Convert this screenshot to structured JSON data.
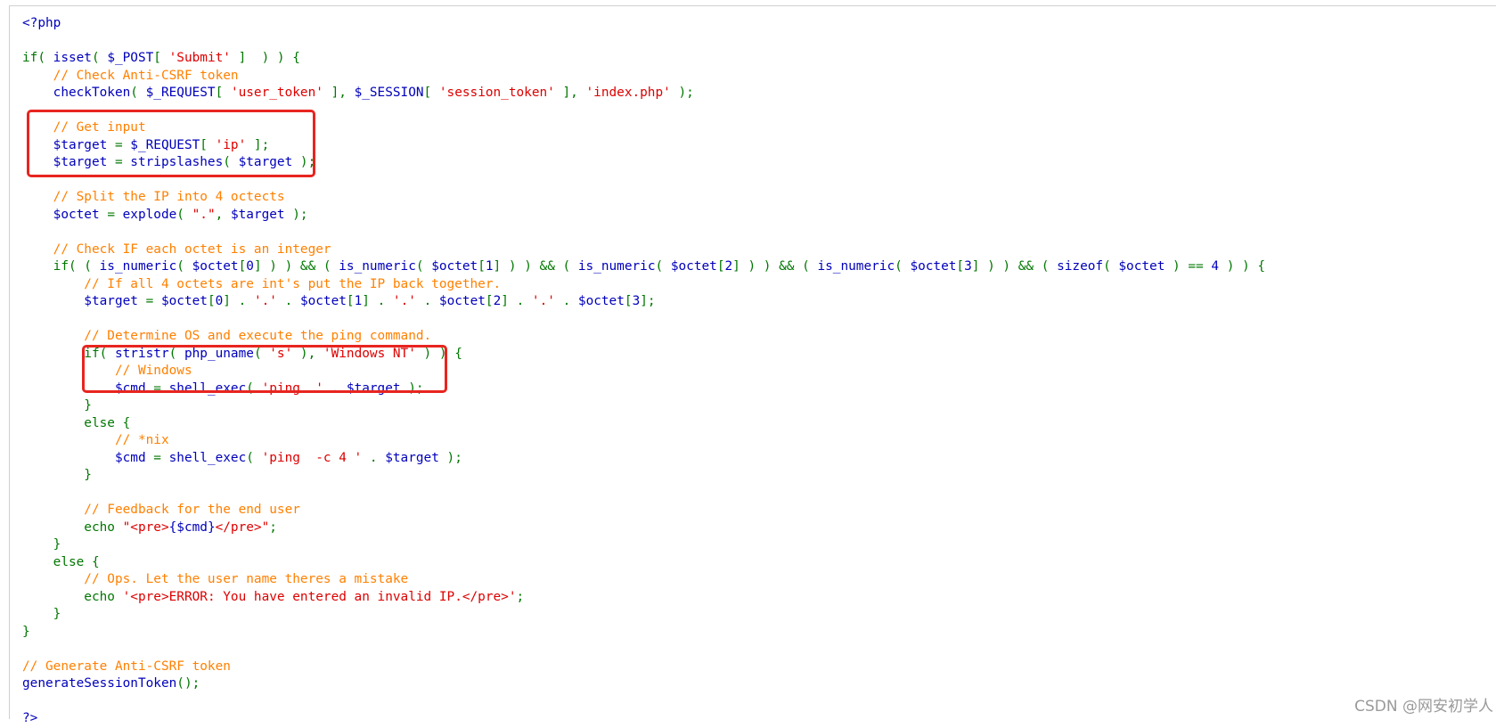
{
  "code_lines": [
    [
      {
        "t": "php",
        "v": "<?php"
      }
    ],
    [],
    [
      {
        "t": "kw",
        "v": "if( "
      },
      {
        "t": "fn",
        "v": "isset"
      },
      {
        "t": "kw",
        "v": "( "
      },
      {
        "t": "fn",
        "v": "$_POST"
      },
      {
        "t": "kw",
        "v": "[ "
      },
      {
        "t": "str",
        "v": "'Submit'"
      },
      {
        "t": "kw",
        "v": " ]  ) ) {"
      }
    ],
    [
      {
        "t": "com",
        "v": "    // Check Anti-CSRF token"
      }
    ],
    [
      {
        "t": "fn",
        "v": "    checkToken"
      },
      {
        "t": "kw",
        "v": "( "
      },
      {
        "t": "fn",
        "v": "$_REQUEST"
      },
      {
        "t": "kw",
        "v": "[ "
      },
      {
        "t": "str",
        "v": "'user_token'"
      },
      {
        "t": "kw",
        "v": " ], "
      },
      {
        "t": "fn",
        "v": "$_SESSION"
      },
      {
        "t": "kw",
        "v": "[ "
      },
      {
        "t": "str",
        "v": "'session_token'"
      },
      {
        "t": "kw",
        "v": " ], "
      },
      {
        "t": "str",
        "v": "'index.php'"
      },
      {
        "t": "kw",
        "v": " );"
      }
    ],
    [],
    [
      {
        "t": "com",
        "v": "    // Get input"
      }
    ],
    [
      {
        "t": "fn",
        "v": "    $target "
      },
      {
        "t": "kw",
        "v": "= "
      },
      {
        "t": "fn",
        "v": "$_REQUEST"
      },
      {
        "t": "kw",
        "v": "[ "
      },
      {
        "t": "str",
        "v": "'ip'"
      },
      {
        "t": "kw",
        "v": " ];"
      }
    ],
    [
      {
        "t": "fn",
        "v": "    $target "
      },
      {
        "t": "kw",
        "v": "= "
      },
      {
        "t": "fn",
        "v": "stripslashes"
      },
      {
        "t": "kw",
        "v": "( "
      },
      {
        "t": "fn",
        "v": "$target "
      },
      {
        "t": "kw",
        "v": ");"
      }
    ],
    [],
    [
      {
        "t": "com",
        "v": "    // Split the IP into 4 octects"
      }
    ],
    [
      {
        "t": "fn",
        "v": "    $octet "
      },
      {
        "t": "kw",
        "v": "= "
      },
      {
        "t": "fn",
        "v": "explode"
      },
      {
        "t": "kw",
        "v": "( "
      },
      {
        "t": "str",
        "v": "\".\""
      },
      {
        "t": "kw",
        "v": ", "
      },
      {
        "t": "fn",
        "v": "$target "
      },
      {
        "t": "kw",
        "v": ");"
      }
    ],
    [],
    [
      {
        "t": "com",
        "v": "    // Check IF each octet is an integer"
      }
    ],
    [
      {
        "t": "kw",
        "v": "    if( ( "
      },
      {
        "t": "fn",
        "v": "is_numeric"
      },
      {
        "t": "kw",
        "v": "( "
      },
      {
        "t": "fn",
        "v": "$octet"
      },
      {
        "t": "kw",
        "v": "["
      },
      {
        "t": "fn",
        "v": "0"
      },
      {
        "t": "kw",
        "v": "] ) ) && ( "
      },
      {
        "t": "fn",
        "v": "is_numeric"
      },
      {
        "t": "kw",
        "v": "( "
      },
      {
        "t": "fn",
        "v": "$octet"
      },
      {
        "t": "kw",
        "v": "["
      },
      {
        "t": "fn",
        "v": "1"
      },
      {
        "t": "kw",
        "v": "] ) ) && ( "
      },
      {
        "t": "fn",
        "v": "is_numeric"
      },
      {
        "t": "kw",
        "v": "( "
      },
      {
        "t": "fn",
        "v": "$octet"
      },
      {
        "t": "kw",
        "v": "["
      },
      {
        "t": "fn",
        "v": "2"
      },
      {
        "t": "kw",
        "v": "] ) ) && ( "
      },
      {
        "t": "fn",
        "v": "is_numeric"
      },
      {
        "t": "kw",
        "v": "( "
      },
      {
        "t": "fn",
        "v": "$octet"
      },
      {
        "t": "kw",
        "v": "["
      },
      {
        "t": "fn",
        "v": "3"
      },
      {
        "t": "kw",
        "v": "] ) ) && ( "
      },
      {
        "t": "fn",
        "v": "sizeof"
      },
      {
        "t": "kw",
        "v": "( "
      },
      {
        "t": "fn",
        "v": "$octet "
      },
      {
        "t": "kw",
        "v": ") == "
      },
      {
        "t": "fn",
        "v": "4 "
      },
      {
        "t": "kw",
        "v": ") ) {"
      }
    ],
    [
      {
        "t": "com",
        "v": "        // If all 4 octets are int's put the IP back together."
      }
    ],
    [
      {
        "t": "fn",
        "v": "        $target "
      },
      {
        "t": "kw",
        "v": "= "
      },
      {
        "t": "fn",
        "v": "$octet"
      },
      {
        "t": "kw",
        "v": "["
      },
      {
        "t": "fn",
        "v": "0"
      },
      {
        "t": "kw",
        "v": "] . "
      },
      {
        "t": "str",
        "v": "'.'"
      },
      {
        "t": "kw",
        "v": " . "
      },
      {
        "t": "fn",
        "v": "$octet"
      },
      {
        "t": "kw",
        "v": "["
      },
      {
        "t": "fn",
        "v": "1"
      },
      {
        "t": "kw",
        "v": "] . "
      },
      {
        "t": "str",
        "v": "'.'"
      },
      {
        "t": "kw",
        "v": " . "
      },
      {
        "t": "fn",
        "v": "$octet"
      },
      {
        "t": "kw",
        "v": "["
      },
      {
        "t": "fn",
        "v": "2"
      },
      {
        "t": "kw",
        "v": "] . "
      },
      {
        "t": "str",
        "v": "'.'"
      },
      {
        "t": "kw",
        "v": " . "
      },
      {
        "t": "fn",
        "v": "$octet"
      },
      {
        "t": "kw",
        "v": "["
      },
      {
        "t": "fn",
        "v": "3"
      },
      {
        "t": "kw",
        "v": "];"
      }
    ],
    [],
    [
      {
        "t": "com",
        "v": "        // Determine OS and execute the ping command."
      }
    ],
    [
      {
        "t": "kw",
        "v": "        if( "
      },
      {
        "t": "fn",
        "v": "stristr"
      },
      {
        "t": "kw",
        "v": "( "
      },
      {
        "t": "fn",
        "v": "php_uname"
      },
      {
        "t": "kw",
        "v": "( "
      },
      {
        "t": "str",
        "v": "'s'"
      },
      {
        "t": "kw",
        "v": " ), "
      },
      {
        "t": "str",
        "v": "'Windows NT'"
      },
      {
        "t": "kw",
        "v": " ) ) {"
      }
    ],
    [
      {
        "t": "com",
        "v": "            // Windows"
      }
    ],
    [
      {
        "t": "fn",
        "v": "            $cmd "
      },
      {
        "t": "kw",
        "v": "= "
      },
      {
        "t": "fn",
        "v": "shell_exec"
      },
      {
        "t": "kw",
        "v": "( "
      },
      {
        "t": "str",
        "v": "'ping  '"
      },
      {
        "t": "kw",
        "v": " . "
      },
      {
        "t": "fn",
        "v": "$target "
      },
      {
        "t": "kw",
        "v": ");"
      }
    ],
    [
      {
        "t": "kw",
        "v": "        }"
      }
    ],
    [
      {
        "t": "kw",
        "v": "        else {"
      }
    ],
    [
      {
        "t": "com",
        "v": "            // *nix"
      }
    ],
    [
      {
        "t": "fn",
        "v": "            $cmd "
      },
      {
        "t": "kw",
        "v": "= "
      },
      {
        "t": "fn",
        "v": "shell_exec"
      },
      {
        "t": "kw",
        "v": "( "
      },
      {
        "t": "str",
        "v": "'ping  -c 4 '"
      },
      {
        "t": "kw",
        "v": " . "
      },
      {
        "t": "fn",
        "v": "$target "
      },
      {
        "t": "kw",
        "v": ");"
      }
    ],
    [
      {
        "t": "kw",
        "v": "        }"
      }
    ],
    [],
    [
      {
        "t": "com",
        "v": "        // Feedback for the end user"
      }
    ],
    [
      {
        "t": "kw",
        "v": "        echo "
      },
      {
        "t": "str",
        "v": "\"<pre>"
      },
      {
        "t": "fn",
        "v": "{$cmd}"
      },
      {
        "t": "str",
        "v": "</pre>\""
      },
      {
        "t": "kw",
        "v": ";"
      }
    ],
    [
      {
        "t": "kw",
        "v": "    }"
      }
    ],
    [
      {
        "t": "kw",
        "v": "    else {"
      }
    ],
    [
      {
        "t": "com",
        "v": "        // Ops. Let the user name theres a mistake"
      }
    ],
    [
      {
        "t": "kw",
        "v": "        echo "
      },
      {
        "t": "str",
        "v": "'<pre>ERROR: You have entered an invalid IP.</pre>'"
      },
      {
        "t": "kw",
        "v": ";"
      }
    ],
    [
      {
        "t": "kw",
        "v": "    }"
      }
    ],
    [
      {
        "t": "kw",
        "v": "}"
      }
    ],
    [],
    [
      {
        "t": "com",
        "v": "// Generate Anti-CSRF token"
      }
    ],
    [
      {
        "t": "fn",
        "v": "generateSessionToken"
      },
      {
        "t": "kw",
        "v": "();"
      }
    ],
    [],
    [
      {
        "t": "php",
        "v": "?>"
      }
    ]
  ],
  "watermark": "CSDN @网安初学人",
  "colors": {
    "keyword": "#007700",
    "function": "#0000bb",
    "string": "#dd0000",
    "comment": "#ff8000",
    "highlight_box": "#e8241f"
  }
}
